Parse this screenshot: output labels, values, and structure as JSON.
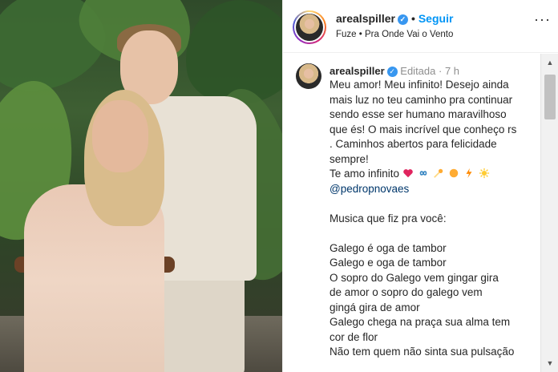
{
  "header": {
    "username": "arealspiller",
    "follow_label": "Seguir",
    "separator": "•",
    "audio": "Fuze • Pra Onde Vai o Vento",
    "more_icon": "more-horizontal-icon"
  },
  "caption": {
    "username": "arealspiller",
    "edited": "Editada",
    "time": "7 h",
    "lines": [
      "Meu amor! Meu infinito! Desejo ainda",
      "mais luz no teu caminho pra continuar",
      "sendo esse ser humano maravilhoso",
      "que és! O mais incrível que conheço rs",
      ". Caminhos abertos para felicidade",
      "sempre!"
    ],
    "love_line": "Te amo infinito",
    "mention": "@pedropnovaes",
    "song_title": "Musica que fiz pra você:",
    "song_lines": [
      "Galego é oga de tambor",
      "Galego e oga de tambor",
      "O sopro do Galego vem gingar gira",
      "de amor o sopro do galego vem",
      "gingá gira de amor",
      "Galego chega na praça sua alma tem",
      "cor de flor",
      "Não tem quem não sinta sua pulsação"
    ]
  },
  "colors": {
    "link_blue": "#0095f6",
    "verified_blue": "#3897f0",
    "mention_blue": "#00376b",
    "meta_gray": "#8e8e8e"
  },
  "emojis": [
    "heart-icon",
    "infinity-icon",
    "comet-icon",
    "sun-icon",
    "lightning-icon",
    "sparkle-icon"
  ]
}
